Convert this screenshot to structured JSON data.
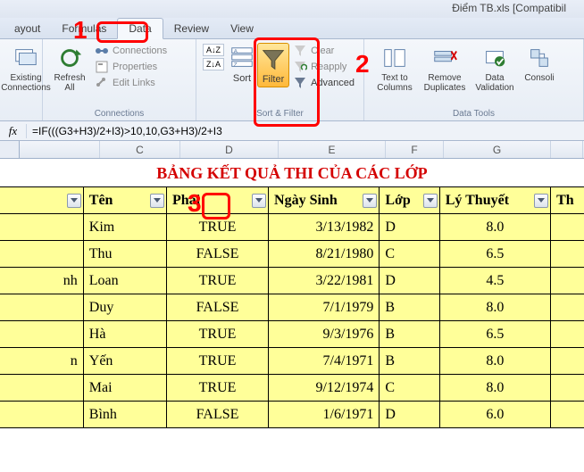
{
  "title": "Điểm TB.xls  [Compatibil",
  "tabs": [
    "ayout",
    "Formulas",
    "Data",
    "Review",
    "View"
  ],
  "active_tab": "Data",
  "ribbon": {
    "existing_connections": "Existing\nConnections",
    "refresh_all": "Refresh\nAll",
    "connections": "Connections",
    "properties": "Properties",
    "edit_links": "Edit Links",
    "group_connections": "Connections",
    "sort": "Sort",
    "filter": "Filter",
    "clear": "Clear",
    "reapply": "Reapply",
    "advanced": "Advanced",
    "group_sortfilter": "Sort & Filter",
    "text_to_columns": "Text to\nColumns",
    "remove_duplicates": "Remove\nDuplicates",
    "data_validation": "Data\nValidation",
    "consolidate": "Consoli",
    "group_datatools": "Data Tools"
  },
  "formula": {
    "label": "fx",
    "value": "=IF(((G3+H3)/2+I3)>10,10,G3+H3)/2+I3"
  },
  "columns": {
    "b": "",
    "c": "C",
    "d": "D",
    "e": "E",
    "f": "F",
    "g": "G",
    "h": ""
  },
  "sheet_title": "BẢNG KẾT QUẢ THI CỦA CÁC LỚP",
  "headers": {
    "col_b": "",
    "ten": "Tên",
    "phai": "Phái",
    "ngaysinh": "Ngày Sinh",
    "lop": "Lớp",
    "lythuyet": "Lý Thuyết",
    "th": "Th"
  },
  "rows": [
    {
      "b": "",
      "ten": "Kim",
      "phai": "TRUE",
      "ngaysinh": "3/13/1982",
      "lop": "D",
      "lythuyet": "8.0"
    },
    {
      "b": "",
      "ten": "Thu",
      "phai": "FALSE",
      "ngaysinh": "8/21/1980",
      "lop": "C",
      "lythuyet": "6.5"
    },
    {
      "b": "nh",
      "ten": "Loan",
      "phai": "TRUE",
      "ngaysinh": "3/22/1981",
      "lop": "D",
      "lythuyet": "4.5"
    },
    {
      "b": "",
      "ten": "Duy",
      "phai": "FALSE",
      "ngaysinh": "7/1/1979",
      "lop": "B",
      "lythuyet": "8.0"
    },
    {
      "b": "",
      "ten": "Hà",
      "phai": "TRUE",
      "ngaysinh": "9/3/1976",
      "lop": "B",
      "lythuyet": "6.5"
    },
    {
      "b": "n",
      "ten": "Yến",
      "phai": "TRUE",
      "ngaysinh": "7/4/1971",
      "lop": "B",
      "lythuyet": "8.0"
    },
    {
      "b": "",
      "ten": "Mai",
      "phai": "TRUE",
      "ngaysinh": "9/12/1974",
      "lop": "C",
      "lythuyet": "8.0"
    },
    {
      "b": "",
      "ten": "Bình",
      "phai": "FALSE",
      "ngaysinh": "1/6/1971",
      "lop": "D",
      "lythuyet": "6.0"
    }
  ],
  "annotations": {
    "a1": "1",
    "a2": "2",
    "a3": "3"
  }
}
